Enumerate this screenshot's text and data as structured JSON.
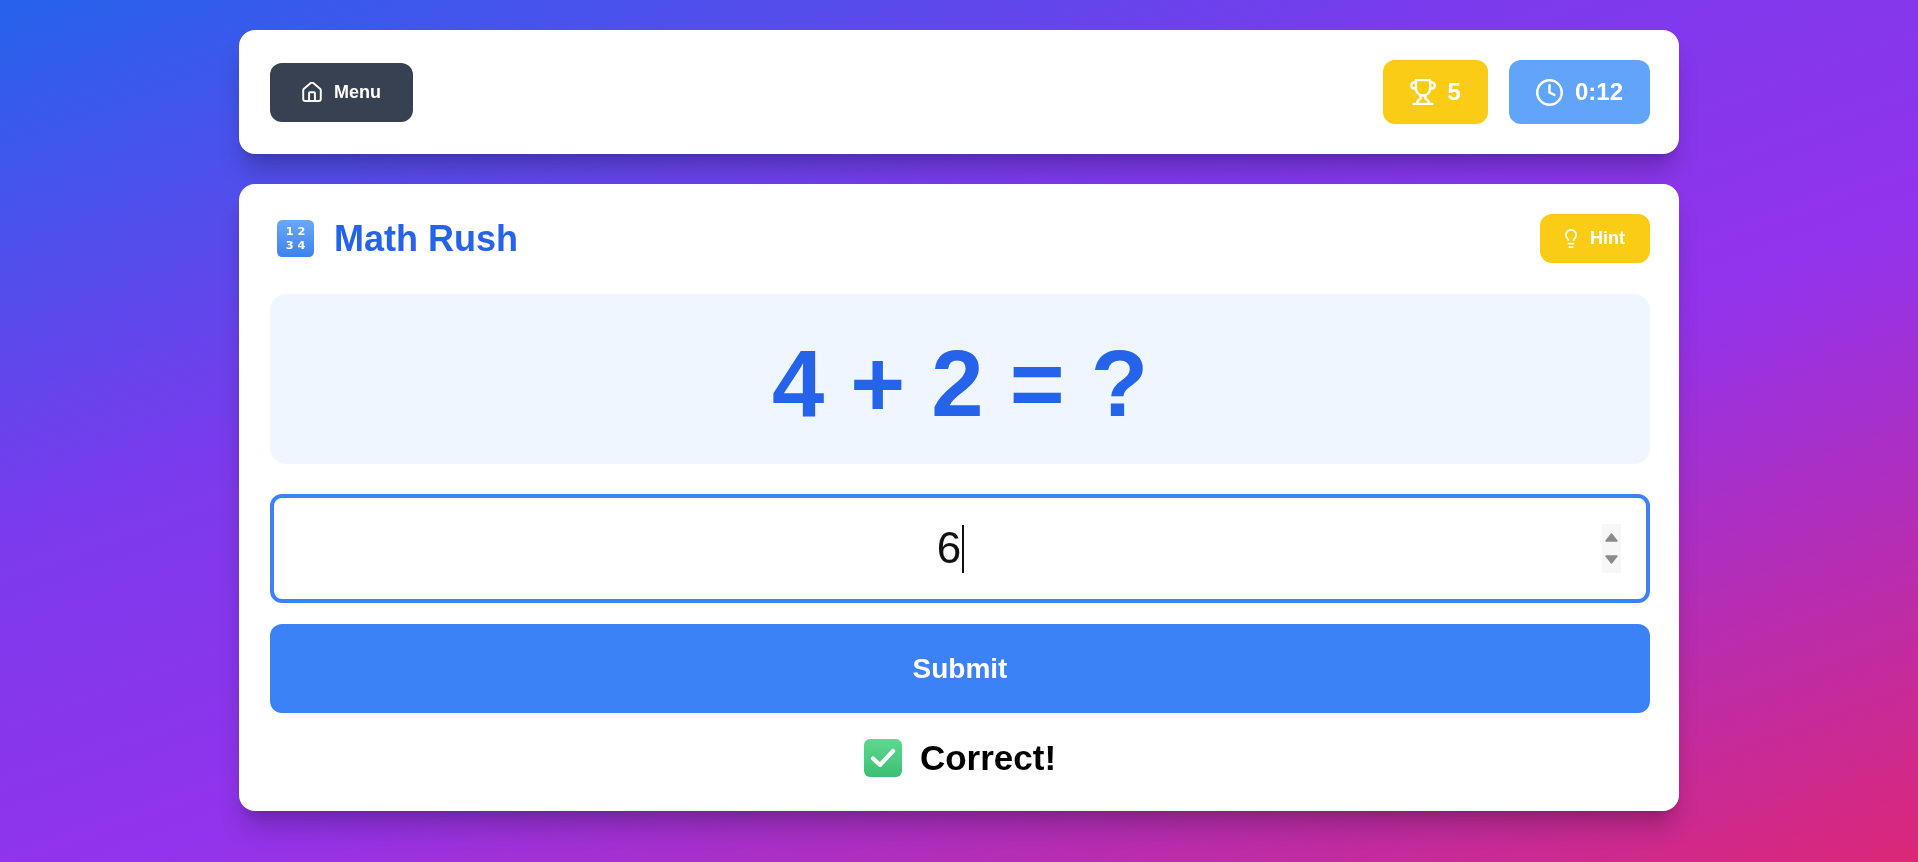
{
  "header": {
    "menu_button": {
      "label": "Menu"
    },
    "score": "5",
    "timer": "0:12"
  },
  "game": {
    "title_icon": {
      "rows": [
        "1 2",
        "3 4"
      ]
    },
    "title": "Math Rush",
    "hint_button": {
      "label": "Hint"
    },
    "problem": "4 + 2 = ?",
    "answer_field": {
      "value": "6",
      "focused": true
    },
    "submit_button": {
      "label": "Submit"
    },
    "feedback": {
      "kind": "correct",
      "text": "Correct!"
    }
  }
}
